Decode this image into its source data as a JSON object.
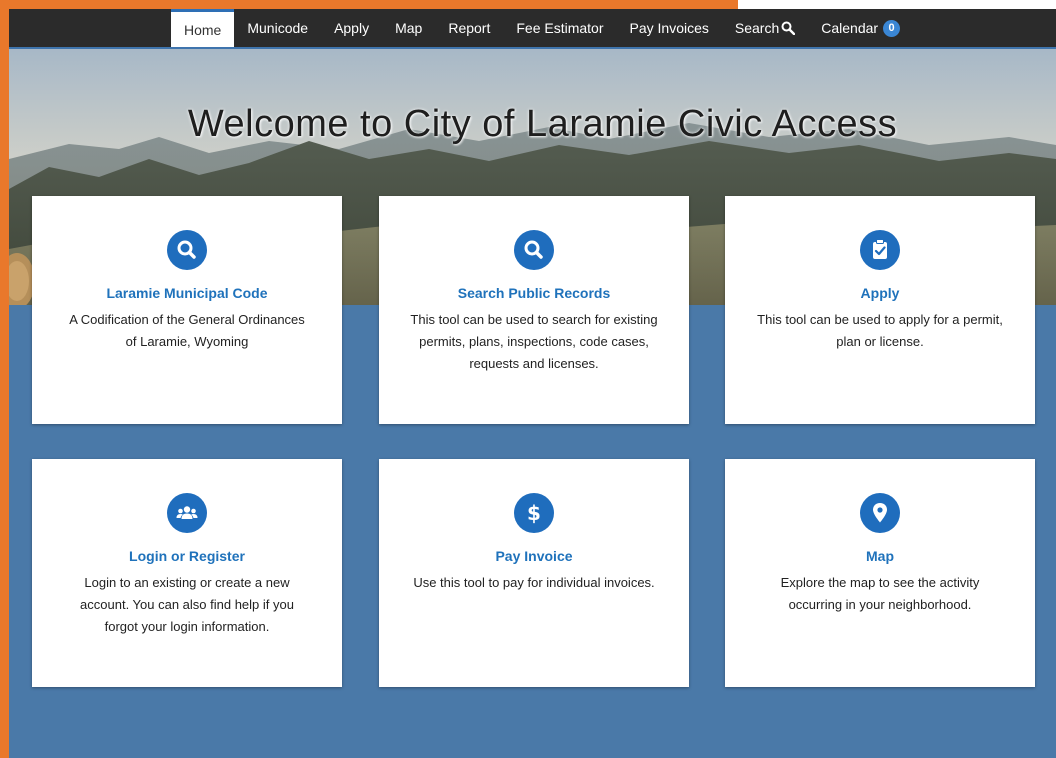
{
  "nav": {
    "items": [
      {
        "label": "Home",
        "active": true
      },
      {
        "label": "Municode"
      },
      {
        "label": "Apply"
      },
      {
        "label": "Map"
      },
      {
        "label": "Report"
      },
      {
        "label": "Fee Estimator"
      },
      {
        "label": "Pay Invoices"
      },
      {
        "label": "Search",
        "icon": "search-icon"
      },
      {
        "label": "Calendar",
        "badge": "0"
      }
    ]
  },
  "hero": {
    "title": "Welcome to City of Laramie Civic Access"
  },
  "cards": [
    {
      "title": "Laramie Municipal Code",
      "description": "A Codification of the General Ordinances of Laramie, Wyoming",
      "icon": "search-icon"
    },
    {
      "title": "Search Public Records",
      "description": "This tool can be used to search for existing permits, plans, inspections, code cases, requests and licenses.",
      "icon": "search-icon"
    },
    {
      "title": "Apply",
      "description": "This tool can be used to apply for a permit, plan or license.",
      "icon": "clipboard-check-icon"
    },
    {
      "title": "Login or Register",
      "description": "Login to an existing or create a new account. You can also find help if you forgot your login information.",
      "icon": "users-icon"
    },
    {
      "title": "Pay Invoice",
      "description": "Use this tool to pay for individual invoices.",
      "icon": "dollar-icon"
    },
    {
      "title": "Map",
      "description": "Explore the map to see the activity occurring in your neighborhood.",
      "icon": "map-pin-icon"
    }
  ],
  "colors": {
    "frame_orange": "#e9782b",
    "nav_bg": "#2b2b2b",
    "accent_blue": "#1f6dbd",
    "page_blue": "#4a79a8",
    "badge_blue": "#3a86d4"
  }
}
